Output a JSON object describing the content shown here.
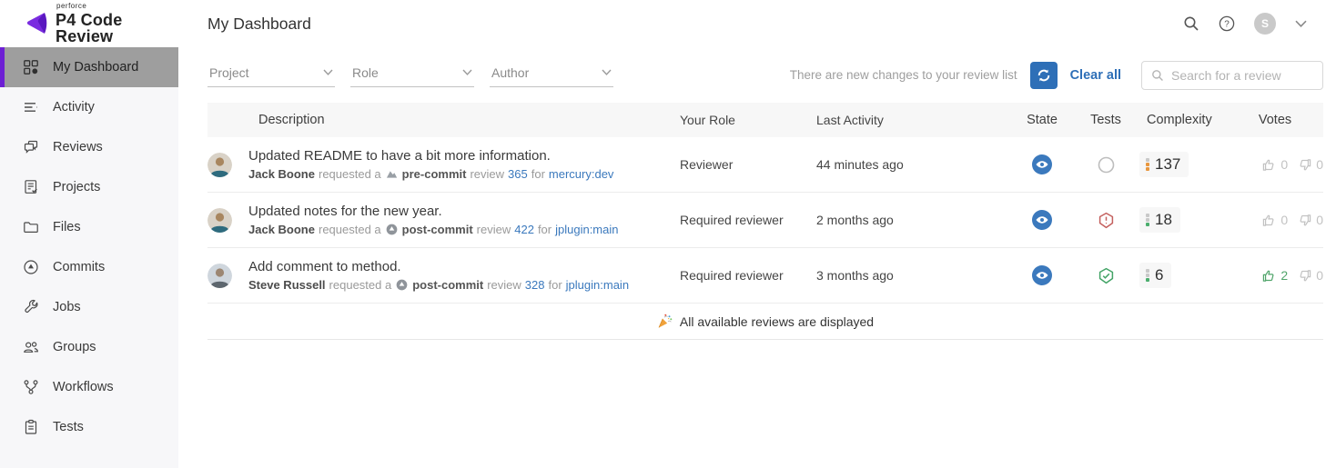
{
  "brand": {
    "superscript": "perforce",
    "name": "P4 Code Review"
  },
  "page_title": "My Dashboard",
  "topbar": {
    "help_glyph": "?",
    "avatar_initial": "S"
  },
  "sidebar": {
    "items": [
      {
        "label": "My Dashboard",
        "icon": "dashboard-grid-icon",
        "active": true
      },
      {
        "label": "Activity",
        "icon": "activity-lines-icon",
        "active": false
      },
      {
        "label": "Reviews",
        "icon": "chat-bubbles-icon",
        "active": false
      },
      {
        "label": "Projects",
        "icon": "project-doc-icon",
        "active": false
      },
      {
        "label": "Files",
        "icon": "folder-icon",
        "active": false
      },
      {
        "label": "Commits",
        "icon": "commit-circle-icon",
        "active": false
      },
      {
        "label": "Jobs",
        "icon": "wrench-icon",
        "active": false
      },
      {
        "label": "Groups",
        "icon": "people-icon",
        "active": false
      },
      {
        "label": "Workflows",
        "icon": "branch-icon",
        "active": false
      },
      {
        "label": "Tests",
        "icon": "clipboard-icon",
        "active": false
      }
    ]
  },
  "filters": {
    "items": [
      {
        "label": "Project"
      },
      {
        "label": "Role"
      },
      {
        "label": "Author"
      }
    ]
  },
  "toolbar": {
    "notice": "There are new changes to your review list",
    "clear_all_label": "Clear all",
    "search_placeholder": "Search for a review"
  },
  "table": {
    "columns": [
      "Description",
      "Your Role",
      "Last Activity",
      "State",
      "Tests",
      "Complexity",
      "Votes"
    ],
    "rows": [
      {
        "title": "Updated README to have a bit more information.",
        "author": "Jack Boone",
        "requested_text": "requested a",
        "commit_type": "pre-commit",
        "review_word": "review",
        "review_id": "365",
        "for_word": "for",
        "branch": "mercury:dev",
        "role": "Reviewer",
        "last_activity": "44 minutes ago",
        "state": "needs-review",
        "tests": "not-run",
        "complexity": "137",
        "complexity_segments": [
          "gray",
          "orange",
          "orange"
        ],
        "votes_up": "0",
        "votes_down": "0"
      },
      {
        "title": "Updated notes for the new year.",
        "author": "Jack Boone",
        "requested_text": "requested a",
        "commit_type": "post-commit",
        "review_word": "review",
        "review_id": "422",
        "for_word": "for",
        "branch": "jplugin:main",
        "role": "Required reviewer",
        "last_activity": "2 months ago",
        "state": "needs-review",
        "tests": "failed",
        "complexity": "18",
        "complexity_segments": [
          "gray",
          "gray",
          "green"
        ],
        "votes_up": "0",
        "votes_down": "0"
      },
      {
        "title": "Add comment to method.",
        "author": "Steve Russell",
        "requested_text": "requested a",
        "commit_type": "post-commit",
        "review_word": "review",
        "review_id": "328",
        "for_word": "for",
        "branch": "jplugin:main",
        "role": "Required reviewer",
        "last_activity": "3 months ago",
        "state": "needs-review",
        "tests": "passed",
        "complexity": "6",
        "complexity_segments": [
          "gray",
          "gray",
          "green"
        ],
        "votes_up": "2",
        "votes_down": "0"
      }
    ],
    "footer_message": "All available reviews are displayed"
  },
  "icons": {
    "search-icon": "magnifier",
    "help-icon": "question-circle",
    "chevron-down-icon": "v",
    "refresh-icon": "circular-arrows",
    "state-needs-review-icon": "blue circle with eye",
    "tests-not-run-icon": "gray ring",
    "tests-failed-icon": "red hexagon exclamation",
    "tests-passed-icon": "green hexagon check",
    "pre-commit-icon": "gray mountain shape",
    "post-commit-icon": "gray circle up-arrow",
    "thumbs-up-icon": "thumb up outline",
    "thumbs-down-icon": "thumb down outline",
    "party-popper-icon": "confetti cone"
  },
  "colors": {
    "brand_purple": "#6d1fd4",
    "active_item_gray": "#9e9e9e",
    "link_blue": "#3b79bd",
    "button_blue": "#2e6fb7",
    "state_blue": "#3b79bd",
    "tests_fail_red": "#c4605e",
    "tests_pass_green": "#44a467",
    "vote_green": "#51a56b",
    "complexity_orange": "#e8973f",
    "complexity_green": "#4cae6e"
  }
}
